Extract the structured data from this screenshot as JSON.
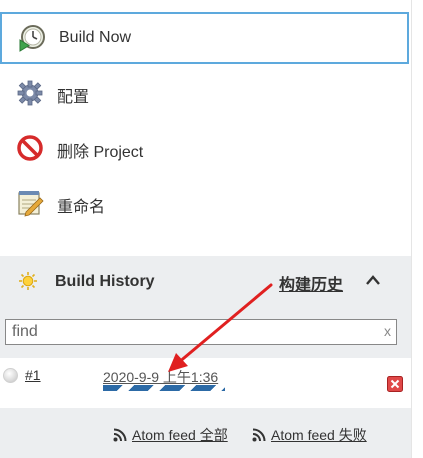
{
  "tasks": [
    {
      "label": "Build Now",
      "icon": "clock-play-icon"
    },
    {
      "label": "配置",
      "icon": "gear-icon"
    },
    {
      "label": "删除 Project",
      "icon": "no-entry-icon"
    },
    {
      "label": "重命名",
      "icon": "notepad-pencil-icon"
    }
  ],
  "build_history": {
    "title": "Build History",
    "trend_link": "构建历史",
    "find_value": "find",
    "find_clear": "x",
    "builds": [
      {
        "number": "#1",
        "date": "2020-9-9 上午1:36",
        "progress": 1.0
      }
    ],
    "feeds": [
      {
        "label": "Atom feed 全部"
      },
      {
        "label": "Atom feed 失败"
      }
    ]
  },
  "colors": {
    "accent_border": "#5da9dd",
    "progress_bar": "#2c6aa6",
    "annotation_arrow": "#e02020",
    "panel_bg": "#eceef0"
  }
}
